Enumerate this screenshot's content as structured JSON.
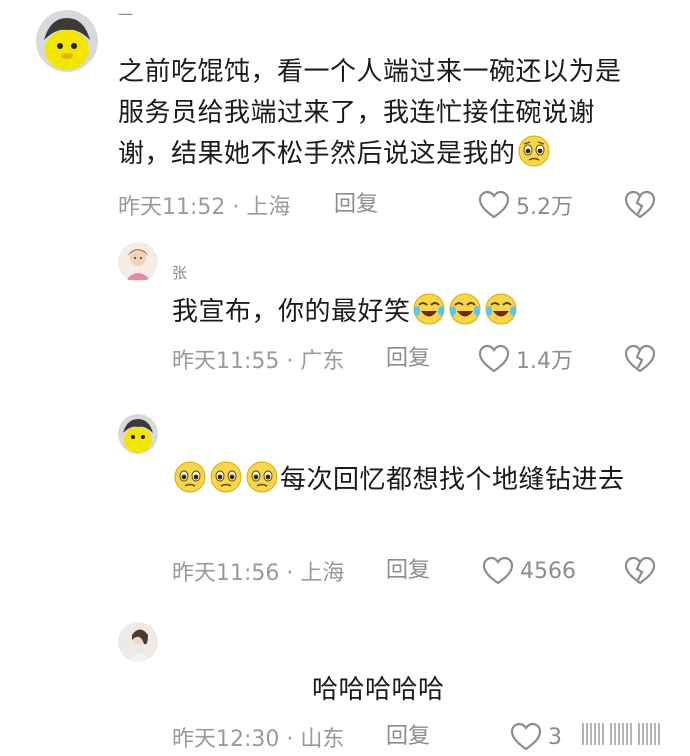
{
  "comments": [
    {
      "username": "一",
      "text": "之前吃馄饨，看一个人端过来一碗还以为是服务员给我端过来了，我连忙接住碗说谢谢，结果她不松手然后说这是我的",
      "emojis": [
        "pleading-face-emoji"
      ],
      "time": "昨天11:52 · 上海",
      "reply": "回复",
      "likes": "5.2万"
    },
    {
      "username": "张",
      "text": "我宣布，你的最好笑",
      "emojis": [
        "crying-laughing-emoji",
        "crying-laughing-emoji",
        "crying-laughing-emoji"
      ],
      "time": "昨天11:55 · 广东",
      "reply": "回复",
      "likes": "1.4万"
    },
    {
      "username": "",
      "text": "每次回忆都想找个地缝钻进去",
      "emojis": [
        "pleading-face-emoji",
        "pleading-face-emoji",
        "pleading-face-emoji"
      ],
      "time": "昨天11:56 · 上海",
      "reply": "回复",
      "likes": "4566"
    },
    {
      "username": "",
      "text": "哈哈哈哈哈",
      "emojis": [],
      "time": "昨天12:30 · 山东",
      "reply": "回复",
      "likes": "3"
    }
  ]
}
